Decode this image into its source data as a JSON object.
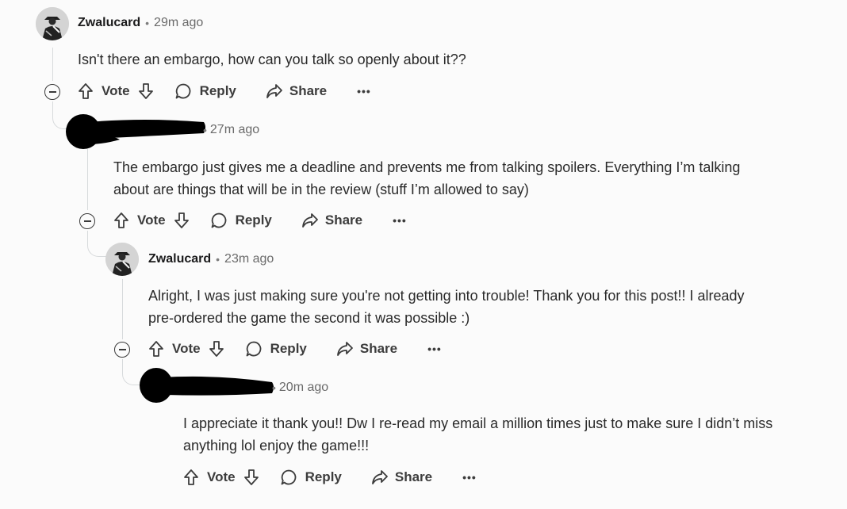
{
  "comments": [
    {
      "username": "Zwalucard",
      "time": "29m ago",
      "text": "Isn't there an embargo, how can you talk so openly about it??",
      "username_redacted": false
    },
    {
      "username": "",
      "time": "27m ago",
      "text_lines": [
        "The embargo just gives me a deadline and prevents me from talking spoilers. Everything I’m talking",
        "about are things that will be in the review (stuff I’m allowed to say)"
      ],
      "username_redacted": true
    },
    {
      "username": "Zwalucard",
      "time": "23m ago",
      "text_lines": [
        "Alright, I was just making sure you're not getting into trouble! Thank you for this post!! I already",
        "pre-ordered the game the second it was possible :)"
      ],
      "username_redacted": false
    },
    {
      "username": "",
      "time": "20m ago",
      "text_lines": [
        "I appreciate it thank you!! Dw I re-read my email a million times just to make sure I didn’t miss",
        "anything lol enjoy the game!!!"
      ],
      "username_redacted": true
    }
  ],
  "actions": {
    "vote": "Vote",
    "reply": "Reply",
    "share": "Share",
    "more": "•••"
  },
  "separator": "•",
  "colors": {
    "background": "#fbfbfb",
    "text": "#1a1a1b",
    "meta": "#6a6a6a",
    "thread_line": "#d7dadc",
    "redaction": "#000000"
  },
  "icons": [
    "arrow-up-icon",
    "arrow-down-icon",
    "speech-bubble-icon",
    "share-arrow-icon",
    "collapse-minus-icon",
    "more-dots-icon"
  ]
}
